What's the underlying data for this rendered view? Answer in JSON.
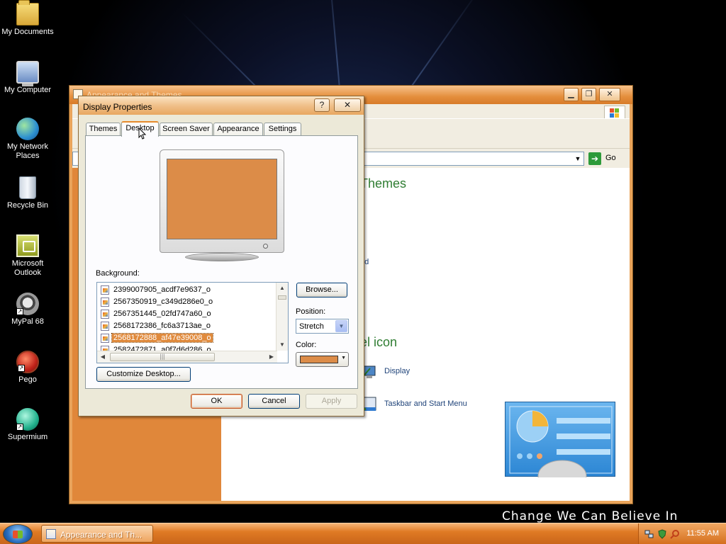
{
  "desktop": {
    "slogan": "Change We Can Believe In",
    "icons": [
      {
        "label": "My Documents",
        "icon": "folder-icon"
      },
      {
        "label": "My Computer",
        "icon": "computer-icon"
      },
      {
        "label": "My Network Places",
        "icon": "network-globe-icon"
      },
      {
        "label": "Recycle Bin",
        "icon": "recycle-bin-icon"
      },
      {
        "label": "Microsoft Outlook",
        "icon": "outlook-icon"
      },
      {
        "label": "MyPal 68",
        "icon": "raccoon-icon"
      },
      {
        "label": "Pego",
        "icon": "pego-icon"
      },
      {
        "label": "Supermium",
        "icon": "supermium-icon"
      }
    ]
  },
  "background_window": {
    "title": "Appearance and Themes",
    "address_go": "Go",
    "heading_themes": "Themes",
    "partial_link": "nd",
    "heading_icon": "el icon",
    "items": [
      {
        "label": "Display",
        "icon": "display-icon"
      },
      {
        "label": "Taskbar and Start Menu",
        "icon": "taskbar-icon"
      }
    ]
  },
  "dialog": {
    "title": "Display Properties",
    "help_button": "?",
    "close_button": "✕",
    "tabs": [
      {
        "label": "Themes",
        "active": false
      },
      {
        "label": "Desktop",
        "active": true
      },
      {
        "label": "Screen Saver",
        "active": false
      },
      {
        "label": "Appearance",
        "active": false
      },
      {
        "label": "Settings",
        "active": false
      }
    ],
    "preview_color": "#dc8c48",
    "background_label": "Background:",
    "background_items": [
      {
        "name": "2399007905_acdf7e9637_o",
        "selected": false
      },
      {
        "name": "2567350919_c349d286e0_o",
        "selected": false
      },
      {
        "name": "2567351445_02fd747a60_o",
        "selected": false
      },
      {
        "name": "2568172386_fc6a3713ae_o",
        "selected": false
      },
      {
        "name": "2568172888_af47e39008_o",
        "selected": true
      },
      {
        "name": "2582472871_a0f7d6d286_o",
        "selected": false
      }
    ],
    "browse_button": "Browse...",
    "position_label": "Position:",
    "position_value": "Stretch",
    "color_label": "Color:",
    "color_value": "#dc8c48",
    "customize_button": "Customize Desktop...",
    "ok_button": "OK",
    "cancel_button": "Cancel",
    "apply_button": "Apply"
  },
  "taskbar": {
    "task_label": "Appearance and Th...",
    "clock": "11:55 AM"
  },
  "colors": {
    "accent": "#e07a24",
    "selection": "#e08a3c",
    "heading_green": "#2f7d32"
  }
}
